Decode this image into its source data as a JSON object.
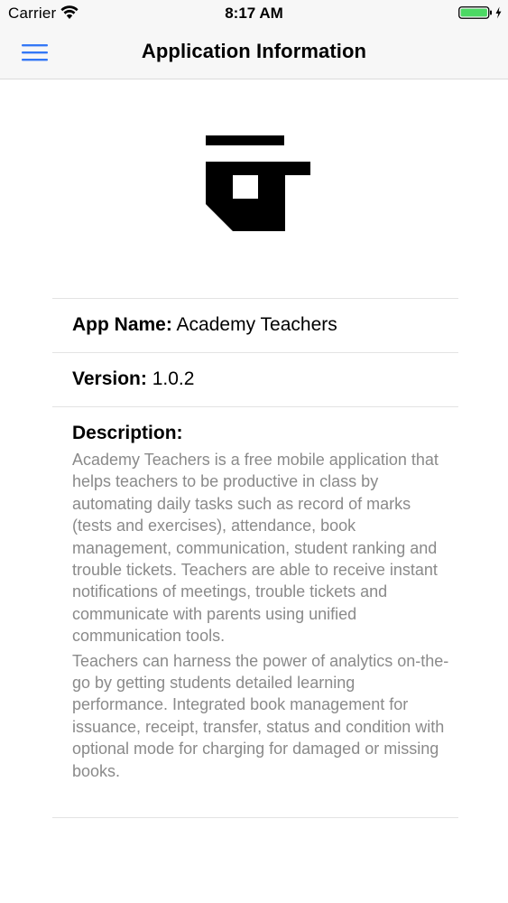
{
  "status_bar": {
    "carrier": "Carrier",
    "time": "8:17 AM",
    "battery_color": "#4cd964"
  },
  "nav": {
    "title": "Application Information",
    "menu_icon": "hamburger-menu-icon",
    "accent_color": "#3478f6"
  },
  "logo": {
    "icon": "app-logo-icon"
  },
  "info": {
    "app_name_label": "App Name:",
    "app_name_value": "Academy Teachers",
    "version_label": "Version:",
    "version_value": "1.0.2",
    "description_label": "Description:",
    "description_paragraphs": [
      "Academy Teachers is a free mobile application that helps teachers to be productive in class by automating daily tasks such as record of marks (tests and exercises), attendance, book management, communication, student ranking and trouble tickets. Teachers are able to receive instant notifications of meetings, trouble tickets and communicate with parents using unified communication tools.",
      "Teachers can harness the power of analytics on-the-go by getting students detailed learning performance. Integrated book management for issuance, receipt, transfer, status and condition with optional mode for charging for damaged or missing books."
    ]
  }
}
